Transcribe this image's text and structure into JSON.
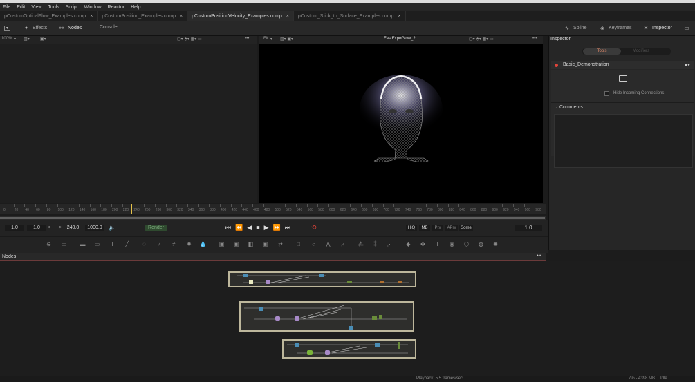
{
  "menu": {
    "items": [
      "File",
      "Edit",
      "View",
      "Tools",
      "Script",
      "Window",
      "Reactor",
      "Help"
    ]
  },
  "tabs": [
    {
      "label": "pCustomOpticalFlow_Examples.comp",
      "active": false
    },
    {
      "label": "pCustomPosition_Examples.comp",
      "active": false
    },
    {
      "label": "pCustomPositionVelocity_Examples.comp",
      "active": true
    },
    {
      "label": "pCustom_Stick_to_Surface_Examples.comp",
      "active": false
    }
  ],
  "tab_close": "×",
  "toolbar": {
    "effects": "Effects",
    "nodes": "Nodes",
    "console": "Console",
    "spline": "Spline",
    "keyframes": "Keyframes",
    "inspector": "Inspector"
  },
  "viewer_left": {
    "zoom": "100%"
  },
  "viewer_right": {
    "fit": "Fit",
    "title": "FastExpoGlow_2"
  },
  "inspector": {
    "title": "Inspector",
    "tab_tools": "Tools",
    "tab_modifiers": "Modifiers",
    "node_name": "Basic_Demonstration",
    "hide_connections": "Hide Incoming Connections",
    "comments": "Comments"
  },
  "ruler": {
    "labels": [
      "0",
      "20",
      "40",
      "60",
      "80",
      "100",
      "120",
      "140",
      "160",
      "180",
      "200",
      "220",
      "240",
      "260",
      "280",
      "300",
      "320",
      "340",
      "360",
      "380",
      "400",
      "420",
      "440",
      "460",
      "480",
      "500",
      "520",
      "540",
      "560",
      "580",
      "600",
      "620",
      "640",
      "660",
      "680",
      "700",
      "720",
      "740",
      "760",
      "780",
      "800",
      "820",
      "840",
      "860",
      "880",
      "900",
      "920",
      "940",
      "960",
      "980"
    ],
    "playhead_fraction": 0.241
  },
  "transport": {
    "start": "1.0",
    "render_start": "1.0",
    "render_end": "240.0",
    "end": "1000.0",
    "render": "Render",
    "hiq": "HiQ",
    "mb": "MB",
    "prx": "Prx",
    "aprx": "APrx",
    "some": "Some",
    "current": "1.0",
    "prev": "<",
    "next": ">"
  },
  "nodes": {
    "title": "Nodes"
  },
  "status": {
    "playback": "Playback: 5.5 frames/sec",
    "memory": "7% - 4398 MB",
    "state": "Idle"
  },
  "colors": {
    "accent_red": "#e0443a",
    "tools_active": "#e58b6a",
    "group_border": "#bdb79c"
  }
}
